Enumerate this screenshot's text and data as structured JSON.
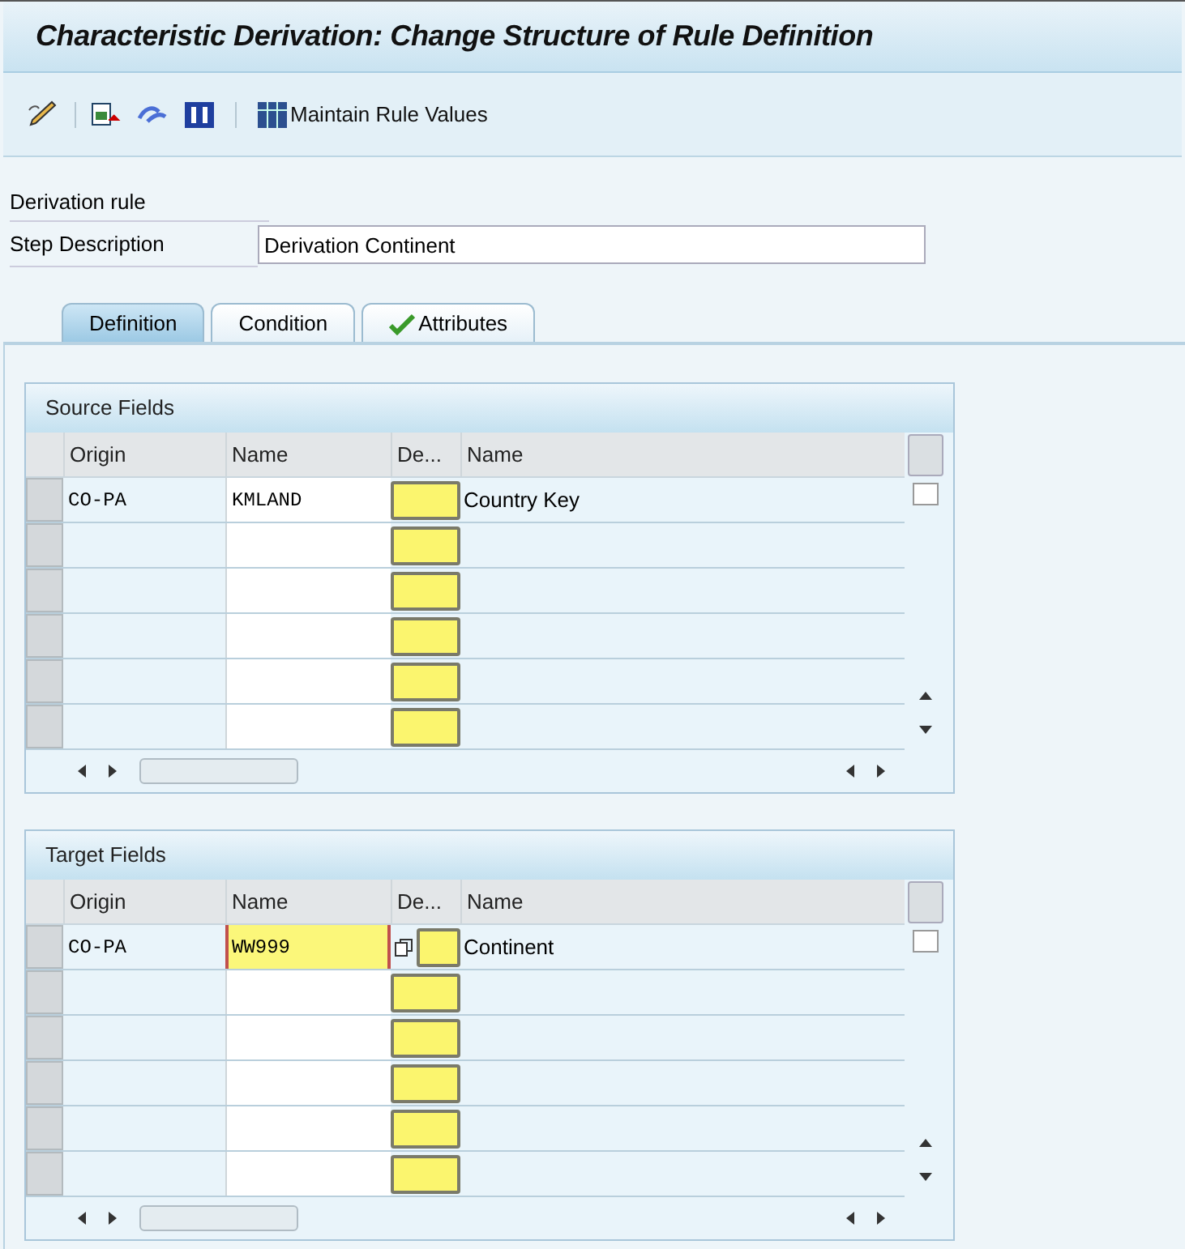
{
  "window": {
    "title": "Characteristic Derivation: Change Structure of Rule Definition"
  },
  "toolbar": {
    "button": "Maintain Rule Values"
  },
  "header": {
    "derivation_rule_label": "Derivation rule",
    "step_label": "Step Description",
    "step_value": "Derivation Continent"
  },
  "tabs": [
    {
      "label": "Definition",
      "selected": true,
      "checked": false
    },
    {
      "label": "Condition",
      "selected": false,
      "checked": false
    },
    {
      "label": "Attributes",
      "selected": false,
      "checked": true
    }
  ],
  "tables": [
    {
      "title": "Source Fields",
      "checked": false,
      "columns": [
        "Origin",
        "Name",
        "De...",
        "Name"
      ],
      "rows": [
        {
          "origin": "CO-PA",
          "name": "KMLAND",
          "description": "Country Key",
          "focused": false
        }
      ]
    },
    {
      "title": "Target Fields",
      "checked": false,
      "columns": [
        "Origin",
        "Name",
        "De...",
        "Name"
      ],
      "rows": [
        {
          "origin": "CO-PA",
          "name": "WW999",
          "description": "Continent",
          "focused": true
        }
      ]
    }
  ]
}
